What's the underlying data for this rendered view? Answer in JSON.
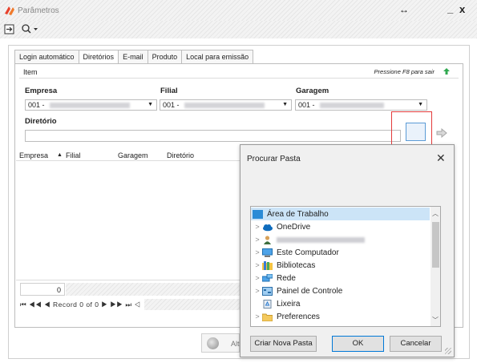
{
  "window": {
    "title": "Parâmetros",
    "restore_glyph": "↔",
    "minimize_glyph": "_",
    "close_glyph": "x"
  },
  "toolbar": {
    "icons": [
      "exit-icon",
      "zoom-icon"
    ]
  },
  "tabs": [
    {
      "label": "Login automático",
      "active": false
    },
    {
      "label": "Diretórios",
      "active": true
    },
    {
      "label": "E-mail",
      "active": false
    },
    {
      "label": "Produto",
      "active": false
    },
    {
      "label": "Local para emissão",
      "active": false
    }
  ],
  "item_bar": {
    "label": "Item",
    "hint": "Pressione F8 para sair"
  },
  "form": {
    "empresa": {
      "label": "Empresa",
      "value": "001 -"
    },
    "filial": {
      "label": "Filial",
      "value": "001 -"
    },
    "garagem": {
      "label": "Garagem",
      "value": "001 -"
    },
    "diretorio": {
      "label": "Diretório",
      "value": ""
    }
  },
  "grid": {
    "columns": [
      "Empresa",
      "Filial",
      "Garagem",
      "Diretório"
    ],
    "sort_indicator": "▲",
    "count": "0",
    "navigator": "⏮ ◀◀ ◀ Record 0 of 0 ▶ ▶▶ ⏭ ◁"
  },
  "bottom_button": {
    "label": "Alt"
  },
  "dialog": {
    "title": "Procurar Pasta",
    "close_glyph": "✕",
    "tree": [
      {
        "label": "Área de Trabalho",
        "expander": "",
        "icon": "desktop-icon",
        "selected": true,
        "indent": 0
      },
      {
        "label": "OneDrive",
        "expander": ">",
        "icon": "cloud-icon",
        "selected": false,
        "indent": 1
      },
      {
        "label": "",
        "expander": ">",
        "icon": "user-icon",
        "selected": false,
        "indent": 1,
        "redacted": true
      },
      {
        "label": "Este Computador",
        "expander": ">",
        "icon": "computer-icon",
        "selected": false,
        "indent": 1
      },
      {
        "label": "Bibliotecas",
        "expander": ">",
        "icon": "library-icon",
        "selected": false,
        "indent": 1
      },
      {
        "label": "Rede",
        "expander": ">",
        "icon": "network-icon",
        "selected": false,
        "indent": 1
      },
      {
        "label": "Painel de Controle",
        "expander": ">",
        "icon": "control-panel-icon",
        "selected": false,
        "indent": 1
      },
      {
        "label": "Lixeira",
        "expander": "",
        "icon": "recycle-bin-icon",
        "selected": false,
        "indent": 1
      },
      {
        "label": "Preferences",
        "expander": ">",
        "icon": "folder-icon",
        "selected": false,
        "indent": 1
      }
    ],
    "buttons": {
      "new_folder": "Criar Nova Pasta",
      "ok": "OK",
      "cancel": "Cancelar"
    }
  },
  "colors": {
    "highlight_border": "#e33b3b",
    "selection": "#cce4f7",
    "accent": "#0078d7"
  }
}
